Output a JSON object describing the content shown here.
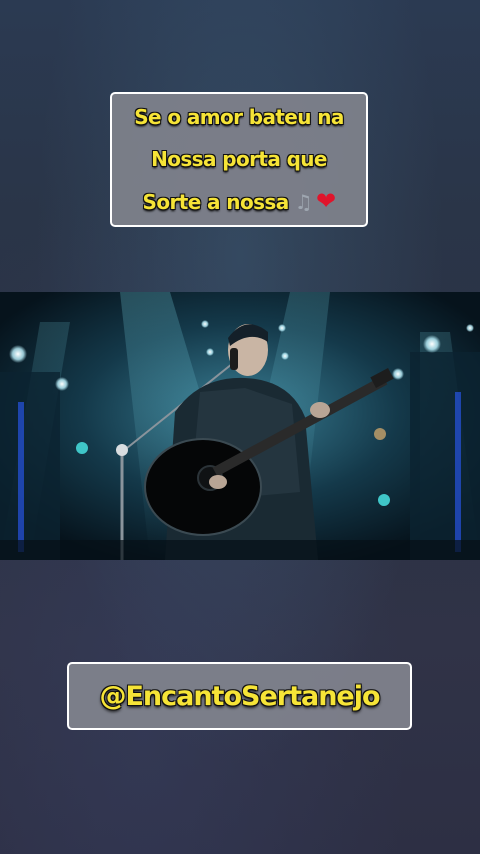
{
  "caption": {
    "lines": [
      "Se o amor bateu na",
      "Nossa porta que",
      "Sorte a nossa"
    ],
    "emoji_icons": [
      "musical-notes-icon",
      "red-heart-icon"
    ]
  },
  "video": {
    "scene": "singer-with-acoustic-guitar-on-stage"
  },
  "watermark": {
    "handle": "@EncantoSertanejo"
  },
  "colors": {
    "caption_text": "#f6e437",
    "caption_bg": "#808289",
    "border": "#ffffff",
    "heart": "#e0142b",
    "stage_light": "#3fb5c9"
  }
}
